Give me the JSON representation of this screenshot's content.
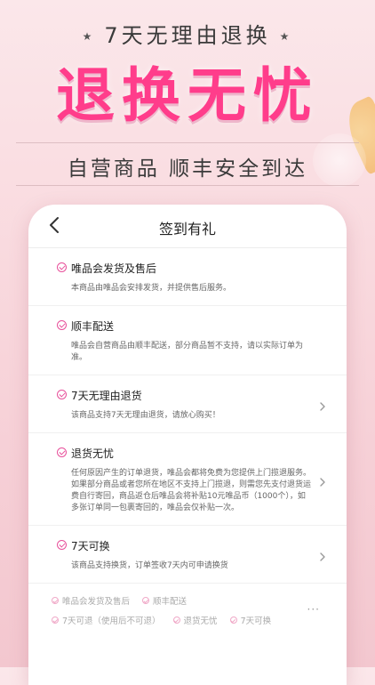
{
  "promo": {
    "tagline": "7天无理由退换",
    "star_left": "★",
    "star_right": "★",
    "headline": "退换无忧",
    "subheadline": "自营商品 顺丰安全到达"
  },
  "nav": {
    "title": "签到有礼"
  },
  "items": [
    {
      "title": "唯品会发货及售后",
      "desc": "本商品由唯品会安排发货，并提供售后服务。",
      "has_chevron": false
    },
    {
      "title": "顺丰配送",
      "desc": "唯品会自营商品由顺丰配送，部分商品暂不支持，请以实际订单为准。",
      "has_chevron": false
    },
    {
      "title": "7天无理由退货",
      "desc": "该商品支持7天无理由退货，请放心购买！",
      "has_chevron": true
    },
    {
      "title": "退货无忧",
      "desc": "任何原因产生的订单退货，唯品会都将免费为您提供上门揽退服务。如果部分商品或者您所在地区不支持上门揽退，则需您先支付退货运费自行寄回，商品返仓后唯品会将补贴10元唯品币（1000个），如多张订单同一包裹寄回的，唯品会仅补贴一次。",
      "has_chevron": true
    },
    {
      "title": "7天可换",
      "desc": "该商品支持换货，订单签收7天内可申请换货",
      "has_chevron": true
    }
  ],
  "summary": {
    "row1": [
      "唯品会发货及售后",
      "顺丰配送"
    ],
    "row2": [
      "7天可退（使用后不可退）",
      "退货无忧",
      "7天可换"
    ],
    "more": "···"
  },
  "colors": {
    "accent": "#e8509b",
    "headline": "#ff3d8b"
  }
}
